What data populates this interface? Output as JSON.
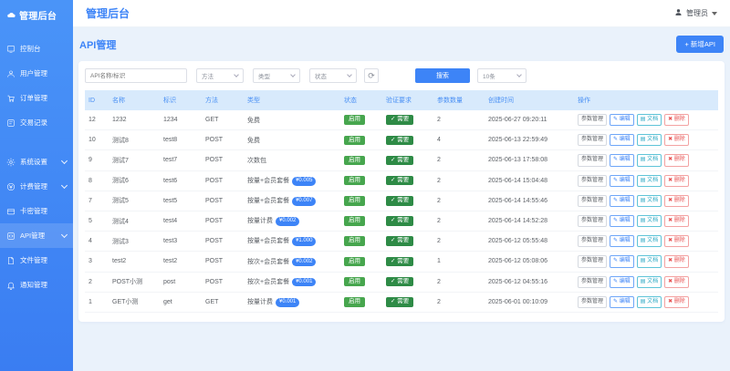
{
  "colors": {
    "accent": "#3d84f7",
    "sidebar_top": "#4a94f8",
    "sidebar_bottom": "#3a7df2",
    "status_green": "#47a64e",
    "verify_green": "#2e8b46",
    "delete_red": "#e85454",
    "table_header_bg": "#d8eafc",
    "page_bg": "#eaf2fb"
  },
  "sidebar": {
    "logo_text": "管理后台",
    "logo_icon": "cloud-icon",
    "items": [
      {
        "label": "控制台",
        "icon": "dashboard-icon",
        "chevron": false,
        "active": false,
        "gap_before": false
      },
      {
        "label": "用户管理",
        "icon": "users-icon",
        "chevron": false,
        "active": false,
        "gap_before": false
      },
      {
        "label": "订单管理",
        "icon": "orders-icon",
        "chevron": false,
        "active": false,
        "gap_before": false
      },
      {
        "label": "交易记录",
        "icon": "transactions-icon",
        "chevron": false,
        "active": false,
        "gap_before": false
      },
      {
        "label": "系统设置",
        "icon": "gear-icon",
        "chevron": true,
        "active": false,
        "gap_before": true
      },
      {
        "label": "计费管理",
        "icon": "billing-icon",
        "chevron": true,
        "active": false,
        "gap_before": false
      },
      {
        "label": "卡密管理",
        "icon": "card-icon",
        "chevron": false,
        "active": false,
        "gap_before": false
      },
      {
        "label": "API管理",
        "icon": "api-icon",
        "chevron": true,
        "active": true,
        "gap_before": false
      },
      {
        "label": "文件管理",
        "icon": "file-icon",
        "chevron": false,
        "active": false,
        "gap_before": false
      },
      {
        "label": "通知管理",
        "icon": "bell-icon",
        "chevron": false,
        "active": false,
        "gap_before": false
      }
    ]
  },
  "header": {
    "title": "管理后台",
    "user": "管理员"
  },
  "page": {
    "title": "API管理",
    "add_button": "+ 新增API"
  },
  "filters": {
    "search_placeholder": "API名称/标识",
    "method_select": "方法",
    "type_select": "类型",
    "status_select": "状态",
    "refresh_icon": "refresh-icon",
    "search_button": "搜索",
    "page_size": "10条"
  },
  "table": {
    "headers": [
      "ID",
      "名称",
      "标识",
      "方法",
      "类型",
      "状态",
      "验证要求",
      "参数数量",
      "创建时间",
      "操作"
    ],
    "status_label": "启用",
    "verify_label": "需要",
    "action_labels": {
      "params": "参数管理",
      "edit": "编辑",
      "docs": "文档",
      "delete": "删除"
    },
    "rows": [
      {
        "id": 12,
        "name": "1232",
        "key": "1234",
        "method": "GET",
        "type": "免费",
        "price": "",
        "params": 2,
        "created": "2025-06-27 09:20:11"
      },
      {
        "id": 10,
        "name": "测试8",
        "key": "test8",
        "method": "POST",
        "type": "免费",
        "price": "",
        "params": 4,
        "created": "2025-06-13 22:59:49"
      },
      {
        "id": 9,
        "name": "测试7",
        "key": "test7",
        "method": "POST",
        "type": "次数包",
        "price": "",
        "params": 2,
        "created": "2025-06-13 17:58:08"
      },
      {
        "id": 8,
        "name": "测试6",
        "key": "test6",
        "method": "POST",
        "type": "按量+会员套餐",
        "price": "¥0.005",
        "params": 2,
        "created": "2025-06-14 15:04:48"
      },
      {
        "id": 7,
        "name": "测试5",
        "key": "test5",
        "method": "POST",
        "type": "按量+会员套餐",
        "price": "¥0.007",
        "params": 2,
        "created": "2025-06-14 14:55:46"
      },
      {
        "id": 5,
        "name": "测试4",
        "key": "test4",
        "method": "POST",
        "type": "按量计费",
        "price": "¥0.002",
        "params": 2,
        "created": "2025-06-14 14:52:28"
      },
      {
        "id": 4,
        "name": "测试3",
        "key": "test3",
        "method": "POST",
        "type": "按量+会员套餐",
        "price": "¥1.000",
        "params": 2,
        "created": "2025-06-12 05:55:48"
      },
      {
        "id": 3,
        "name": "test2",
        "key": "test2",
        "method": "POST",
        "type": "按次+会员套餐",
        "price": "¥0.002",
        "params": 1,
        "created": "2025-06-12 05:08:06"
      },
      {
        "id": 2,
        "name": "POST小测",
        "key": "post",
        "method": "POST",
        "type": "按次+会员套餐",
        "price": "¥0.001",
        "params": 2,
        "created": "2025-06-12 04:55:16"
      },
      {
        "id": 1,
        "name": "GET小测",
        "key": "get",
        "method": "GET",
        "type": "按量计费",
        "price": "¥0.001",
        "params": 2,
        "created": "2025-06-01 00:10:09"
      }
    ]
  }
}
